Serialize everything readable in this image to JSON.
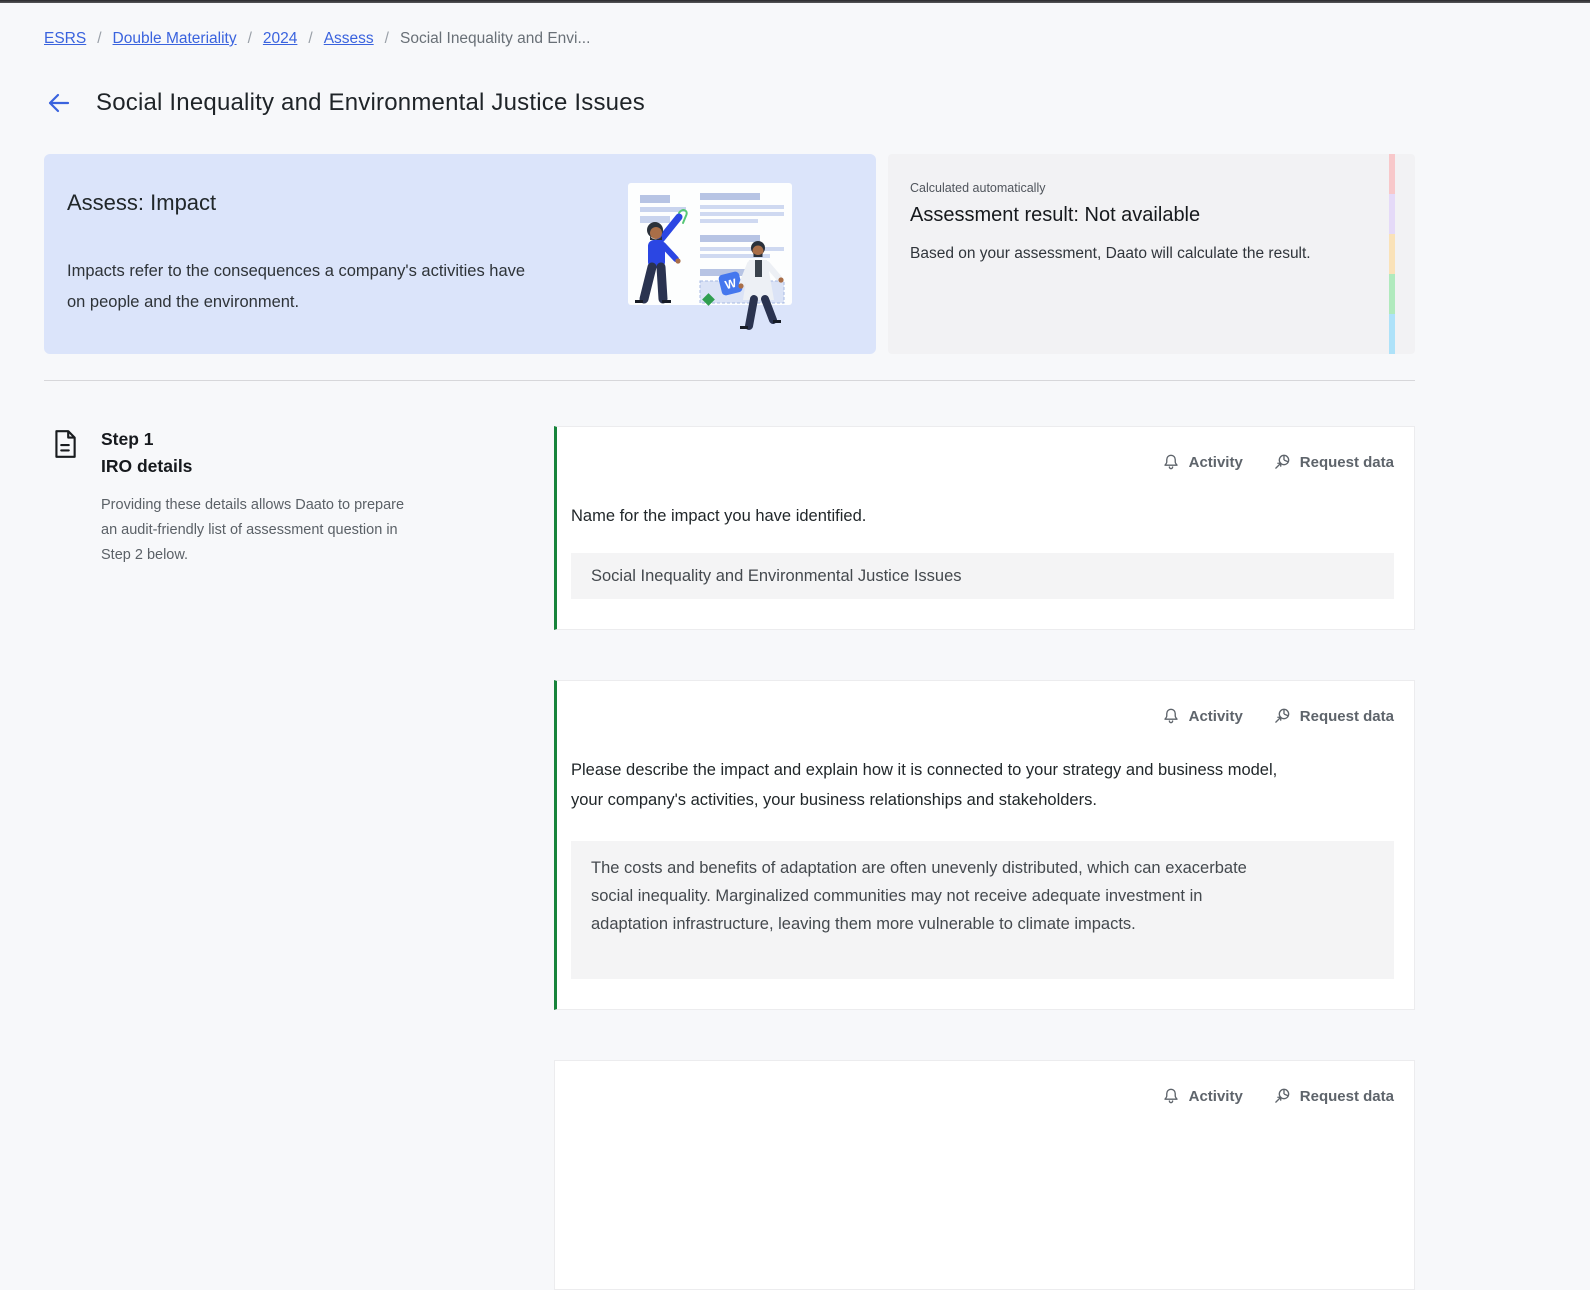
{
  "breadcrumb": {
    "separator": "/",
    "items": [
      {
        "label": "ESRS",
        "link": true
      },
      {
        "label": "Double Materiality",
        "link": true
      },
      {
        "label": "2024",
        "link": true
      },
      {
        "label": "Assess",
        "link": true
      },
      {
        "label": "Social Inequality and Envi...",
        "link": false
      }
    ]
  },
  "page": {
    "title": "Social Inequality and Environmental Justice Issues"
  },
  "hero": {
    "assess_card": {
      "title": "Assess: Impact",
      "description": "Impacts refer to the consequences a company's activities have on people and the environment."
    },
    "result_card": {
      "eyebrow": "Calculated automatically",
      "title": "Assessment result: Not available",
      "description": "Based on your assessment, Daato will calculate the result.",
      "stripe_colors": [
        "#f8c8ca",
        "#e5daf8",
        "#fae2b8",
        "#b0eabd",
        "#aee2f9"
      ]
    }
  },
  "step": {
    "label": "Step 1",
    "name": "IRO details",
    "description": "Providing these details allows Daato to prepare an audit-friendly list of assessment question in Step 2 below."
  },
  "actions": {
    "activity_label": "Activity",
    "request_label": "Request data"
  },
  "cards": [
    {
      "label": "Name for the impact you have identified.",
      "value": "Social Inequality and Environmental Justice Issues"
    },
    {
      "label": "Please describe the impact and explain how it is connected to your strategy and business model, your company's activities, your business relationships and stakeholders.",
      "value": "The costs and benefits of adaptation are often unevenly distributed, which can exacerbate social inequality. Marginalized communities may not receive adequate investment in adaptation infrastructure, leaving them more vulnerable to climate impacts."
    },
    {}
  ],
  "colors": {
    "link_blue": "#3a63de",
    "accent_green": "#17843b",
    "assess_card_bg": "#dbe4fa",
    "result_card_bg": "#f2f2f4",
    "field_bg": "#f4f4f5",
    "page_bg": "#f7f8fa"
  }
}
